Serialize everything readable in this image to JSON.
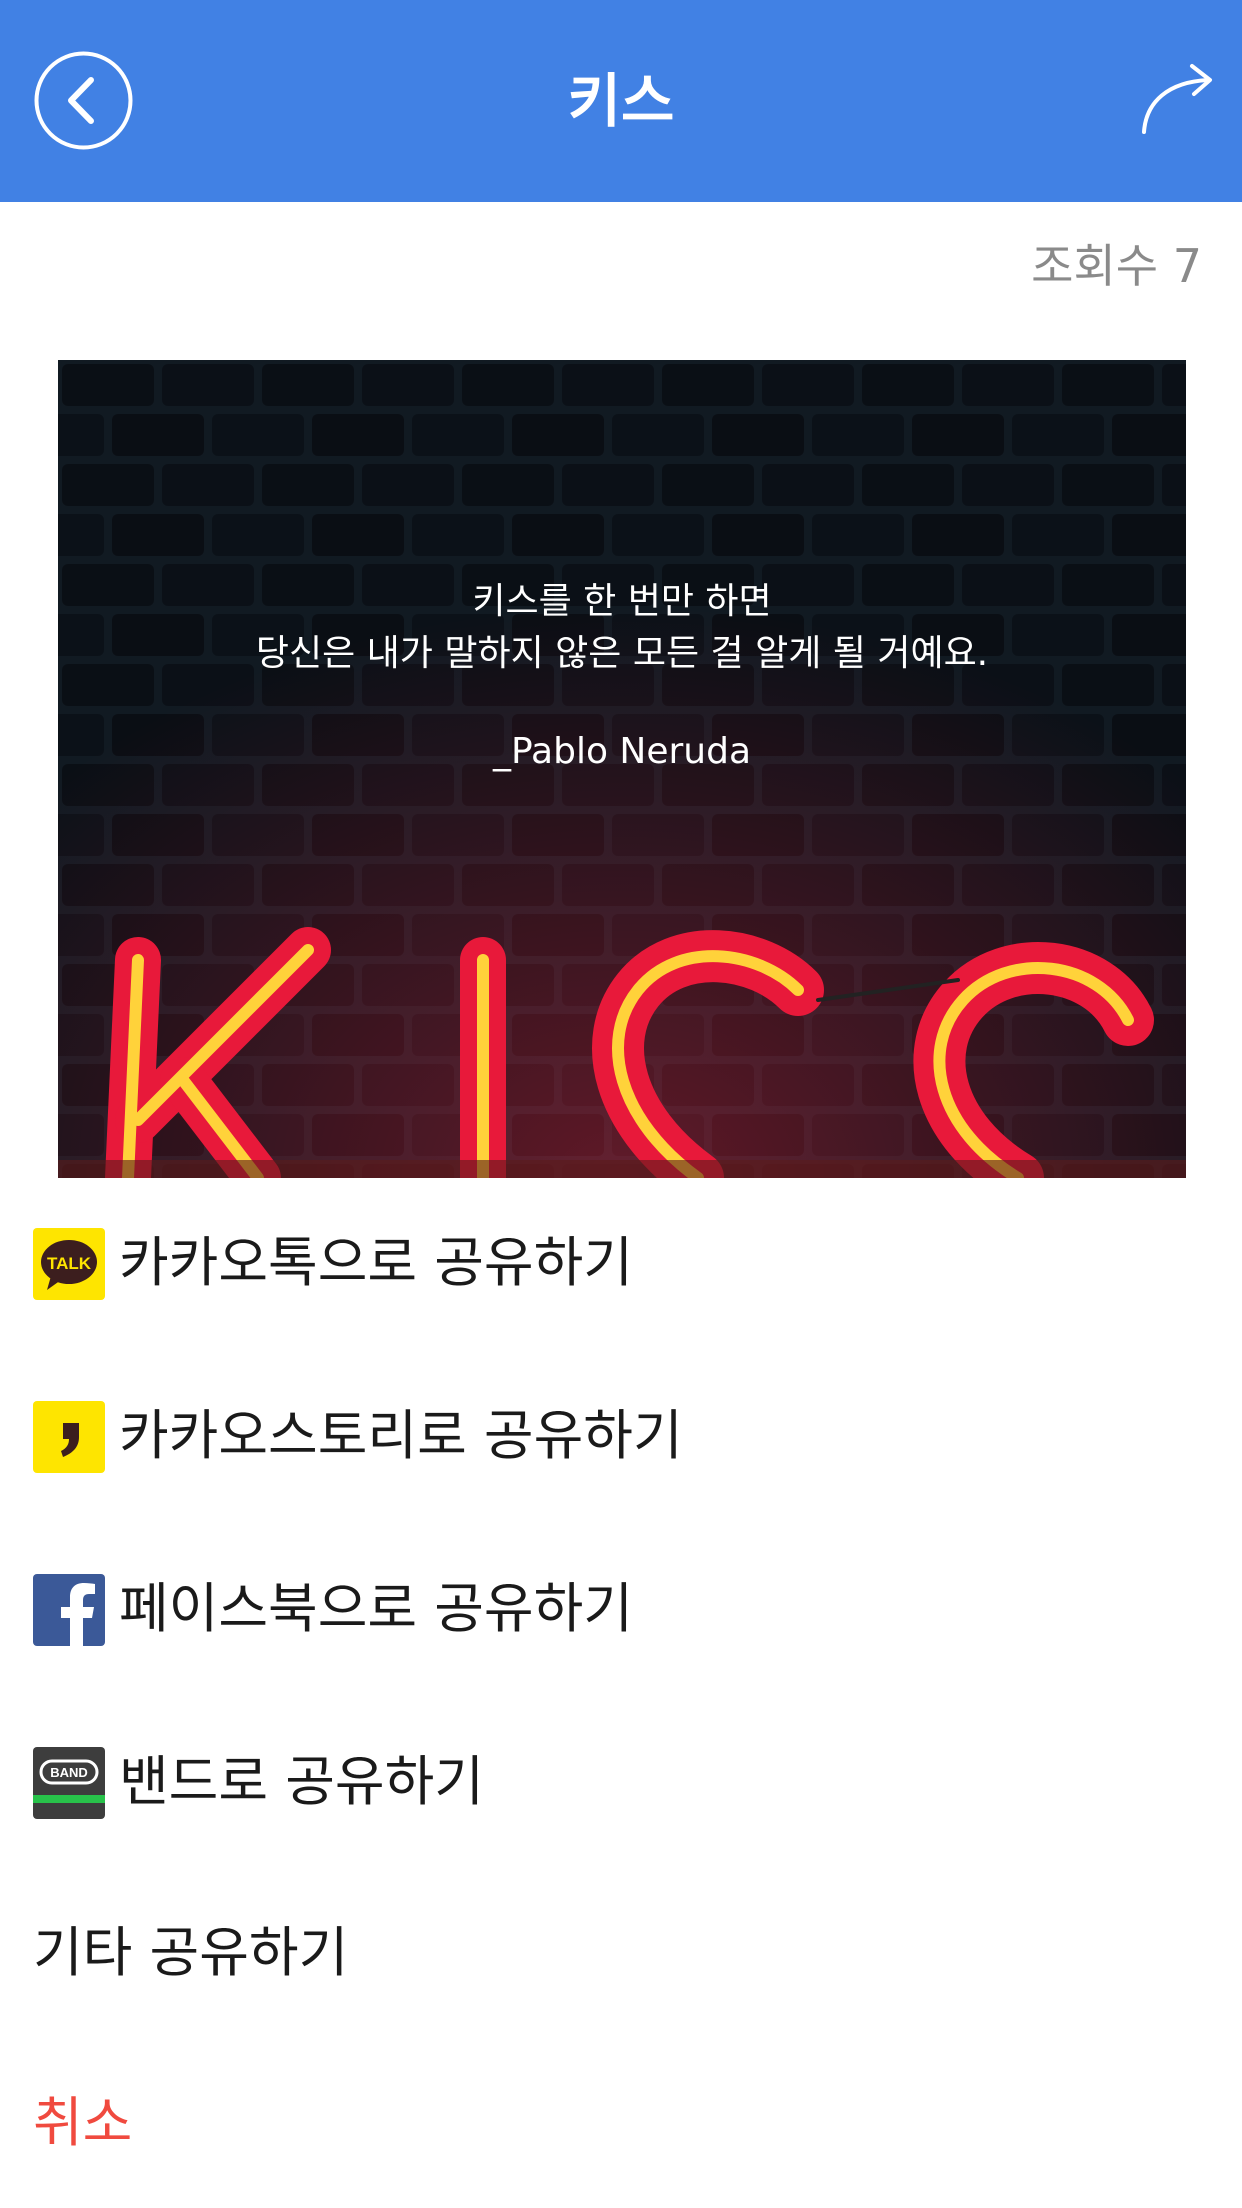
{
  "header": {
    "title": "키스",
    "back_icon": "chevron-left-icon",
    "share_icon": "share-forward-icon",
    "color": "#4181e4"
  },
  "view_count": "조회수 7",
  "image": {
    "quote_line1": "키스를 한 번만 하면",
    "quote_line2": "당신은 내가 말하지 않은 모든 걸 알게 될 거예요.",
    "author": "_Pablo Neruda",
    "neon_text": "KISS"
  },
  "share_options": [
    {
      "label": "카카오톡으로 공유하기",
      "icon": "kakaotalk-icon",
      "icon_text": "TALK"
    },
    {
      "label": "카카오스토리로 공유하기",
      "icon": "kakaostory-icon"
    },
    {
      "label": "페이스북으로 공유하기",
      "icon": "facebook-icon"
    },
    {
      "label": "밴드로 공유하기",
      "icon": "band-icon",
      "icon_text": "BAND"
    },
    {
      "label": "기타 공유하기"
    },
    {
      "label": "취소",
      "color": "#f04a3f"
    }
  ]
}
